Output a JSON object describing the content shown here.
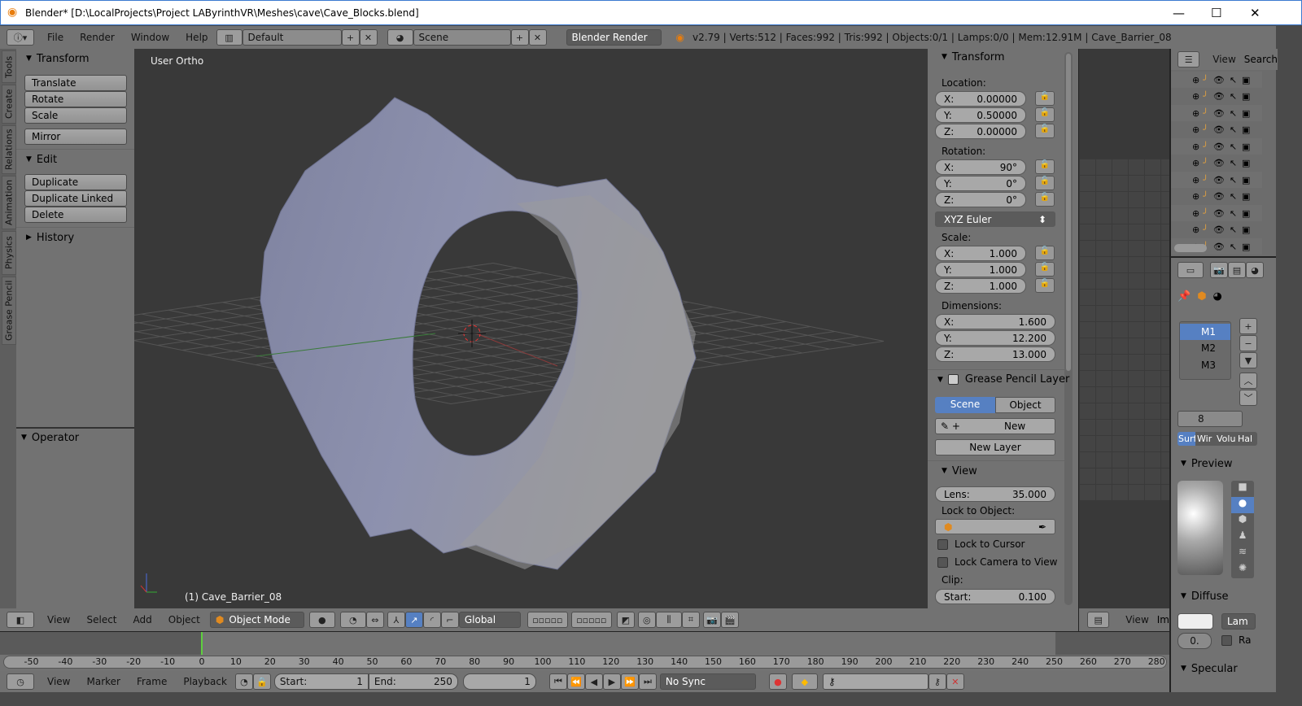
{
  "window": {
    "title": "Blender* [D:\\LocalProjects\\Project LAByrinthVR\\Meshes\\cave\\Cave_Blocks.blend]",
    "minimize": "—",
    "maximize": "☐",
    "close": "✕"
  },
  "info_header": {
    "menus": [
      "File",
      "Render",
      "Window",
      "Help"
    ],
    "layout": "Default",
    "scene": "Scene",
    "engine": "Blender Render",
    "stats": "v2.79 | Verts:512 | Faces:992 | Tris:992 | Objects:0/1 | Lamps:0/0 | Mem:12.91M | Cave_Barrier_08"
  },
  "tool_tabs": [
    "Tools",
    "Create",
    "Relations",
    "Animation",
    "Physics",
    "Grease Pencil"
  ],
  "toolshelf": {
    "transform_title": "Transform",
    "transform_buttons": [
      "Translate",
      "Rotate",
      "Scale"
    ],
    "mirror": "Mirror",
    "edit_title": "Edit",
    "edit_buttons": [
      "Duplicate",
      "Duplicate Linked",
      "Delete"
    ],
    "history_title": "History",
    "operator_title": "Operator"
  },
  "viewport": {
    "view_name": "User Ortho",
    "object_label": "(1) Cave_Barrier_08",
    "mesh_color": "#8a8ea8",
    "background": "#393939"
  },
  "npanel": {
    "transform_title": "Transform",
    "location_label": "Location:",
    "location": [
      {
        "axis": "X:",
        "value": "0.00000"
      },
      {
        "axis": "Y:",
        "value": "0.50000"
      },
      {
        "axis": "Z:",
        "value": "0.00000"
      }
    ],
    "rotation_label": "Rotation:",
    "rotation": [
      {
        "axis": "X:",
        "value": "90°"
      },
      {
        "axis": "Y:",
        "value": "0°"
      },
      {
        "axis": "Z:",
        "value": "0°"
      }
    ],
    "rotation_mode": "XYZ Euler",
    "scale_label": "Scale:",
    "scale": [
      {
        "axis": "X:",
        "value": "1.000"
      },
      {
        "axis": "Y:",
        "value": "1.000"
      },
      {
        "axis": "Z:",
        "value": "1.000"
      }
    ],
    "dimensions_label": "Dimensions:",
    "dimensions": [
      {
        "axis": "X:",
        "value": "1.600"
      },
      {
        "axis": "Y:",
        "value": "12.200"
      },
      {
        "axis": "Z:",
        "value": "13.000"
      }
    ],
    "gp_title": "Grease Pencil Layer",
    "gp_scene": "Scene",
    "gp_object": "Object",
    "gp_new": "New",
    "gp_new_layer": "New Layer",
    "view_title": "View",
    "lens_label": "Lens:",
    "lens": "35.000",
    "lock_to_object": "Lock to Object:",
    "lock_cursor": "Lock to Cursor",
    "lock_camera": "Lock Camera to View",
    "clip": "Clip:",
    "clip_start_label": "Start:",
    "clip_start": "0.100"
  },
  "outliner": {
    "view": "View",
    "search": "Search"
  },
  "properties": {
    "materials": [
      "M1",
      "M2",
      "M3"
    ],
    "users": "8",
    "tabs": [
      "Surf",
      "Wir",
      "Volu",
      "Hal"
    ],
    "preview_title": "Preview",
    "diffuse_title": "Diffuse",
    "diffuse_shader": "Lam",
    "intensity": "0.",
    "ramp": "Ra",
    "specular_title": "Specular"
  },
  "view3d_header": {
    "menus": [
      "View",
      "Select",
      "Add",
      "Object"
    ],
    "mode": "Object Mode",
    "orientation": "Global"
  },
  "small_header": {
    "view": "View",
    "image": "Im"
  },
  "timeline": {
    "ticks": [
      -50,
      -40,
      -30,
      -20,
      -10,
      0,
      10,
      20,
      30,
      40,
      50,
      60,
      70,
      80,
      90,
      100,
      110,
      120,
      130,
      140,
      150,
      160,
      170,
      180,
      190,
      200,
      210,
      220,
      230,
      240,
      250,
      260,
      270,
      280
    ],
    "current_frame": 1,
    "start": 1,
    "end": 250
  },
  "timeline_header": {
    "menus": [
      "View",
      "Marker",
      "Frame",
      "Playback"
    ],
    "start_label": "Start:",
    "start": "1",
    "end_label": "End:",
    "end": "250",
    "frame": "1",
    "sync": "No Sync"
  }
}
